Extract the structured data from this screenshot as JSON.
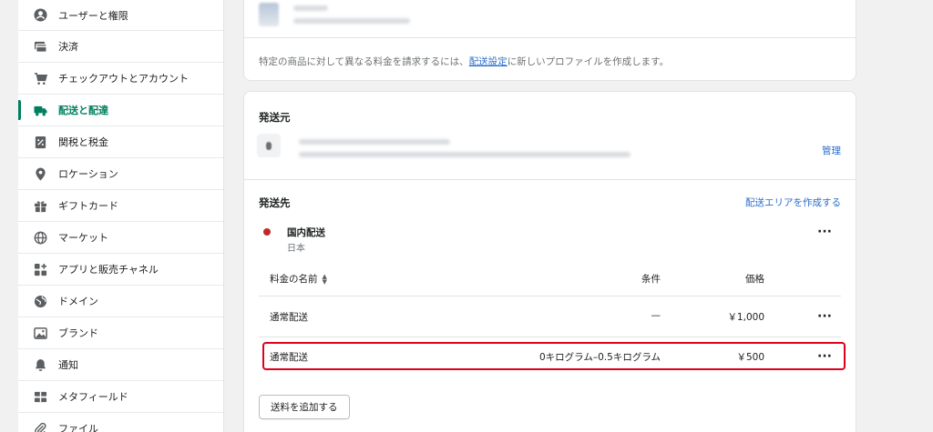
{
  "sidebar": {
    "items": [
      {
        "label": "ユーザーと権限",
        "icon": "user-circle-icon"
      },
      {
        "label": "決済",
        "icon": "payment-icon"
      },
      {
        "label": "チェックアウトとアカウント",
        "icon": "cart-icon"
      },
      {
        "label": "配送と配達",
        "icon": "truck-icon",
        "active": true
      },
      {
        "label": "関税と税金",
        "icon": "tax-icon"
      },
      {
        "label": "ロケーション",
        "icon": "location-pin-icon"
      },
      {
        "label": "ギフトカード",
        "icon": "gift-icon"
      },
      {
        "label": "マーケット",
        "icon": "globe-icon"
      },
      {
        "label": "アプリと販売チャネル",
        "icon": "apps-icon"
      },
      {
        "label": "ドメイン",
        "icon": "domain-globe-icon"
      },
      {
        "label": "ブランド",
        "icon": "brand-image-icon"
      },
      {
        "label": "通知",
        "icon": "bell-icon"
      },
      {
        "label": "メタフィールド",
        "icon": "metafield-icon"
      },
      {
        "label": "ファイル",
        "icon": "paperclip-icon"
      }
    ]
  },
  "profile_card": {
    "note_prefix": "特定の商品に対して異なる料金を請求するには、",
    "note_link": "配送設定",
    "note_suffix": "に新しいプロファイルを作成します。"
  },
  "origin": {
    "title": "発送元",
    "manage_link": "管理"
  },
  "destination": {
    "title": "発送先",
    "create_zone_link": "配送エリアを作成する",
    "zone_name": "国内配送",
    "zone_country": "日本",
    "zone_color": "#c0292b"
  },
  "rates_table": {
    "headers": {
      "name": "料金の名前",
      "condition": "条件",
      "price": "価格"
    },
    "sort_icon": "sort-arrows-icon",
    "rows": [
      {
        "name": "通常配送",
        "condition": "—",
        "price": "￥1,000"
      },
      {
        "name": "通常配送",
        "condition": "0キログラム–0.5キログラム",
        "price": "￥500",
        "highlighted": true
      }
    ]
  },
  "add_rate_button": "送料を追加する",
  "colors": {
    "accent": "#007f5f",
    "link": "#2c6ecb",
    "highlight": "#e0001a"
  }
}
